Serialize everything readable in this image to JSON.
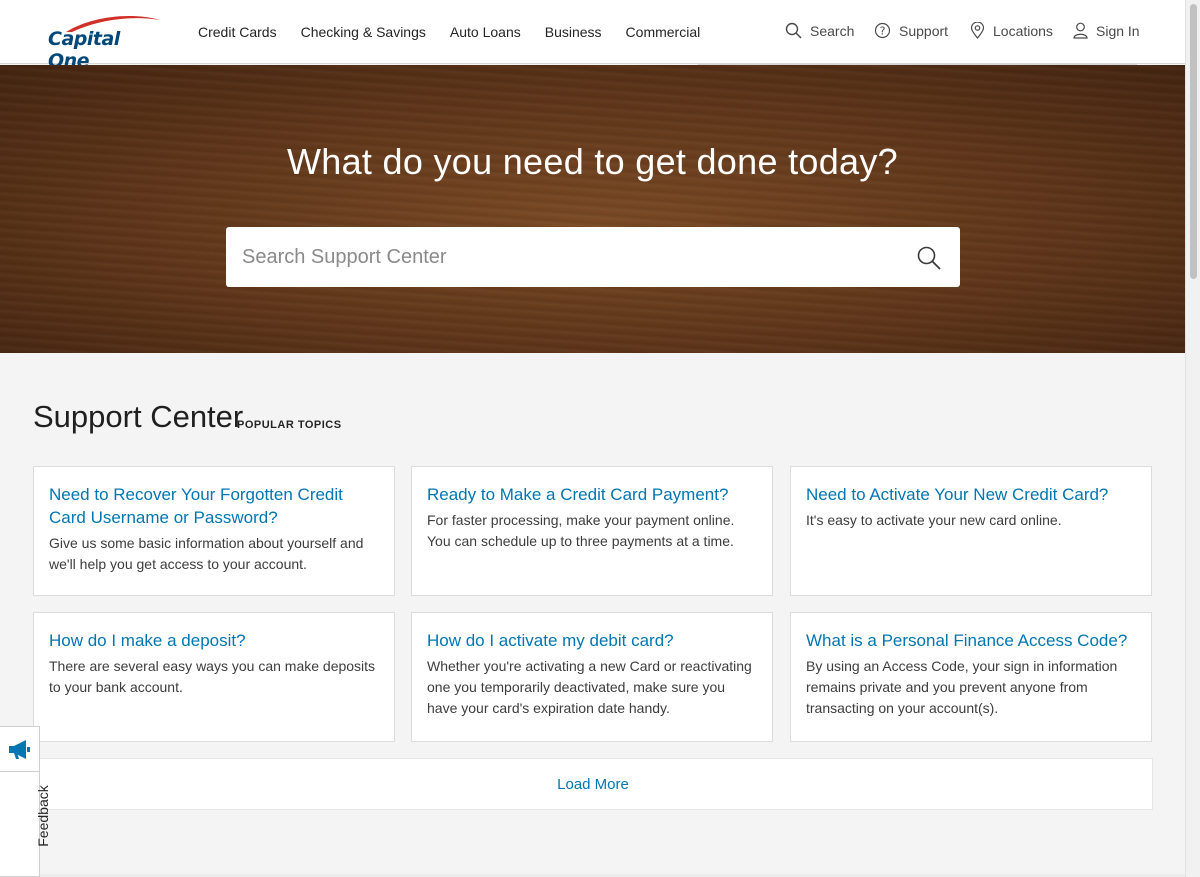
{
  "header": {
    "logo": "Capital One",
    "nav": [
      "Credit Cards",
      "Checking & Savings",
      "Auto Loans",
      "Business",
      "Commercial"
    ],
    "utility": {
      "search": "Search",
      "support": "Support",
      "locations": "Locations",
      "sign_in": "Sign In"
    }
  },
  "hero": {
    "title": "What do you need to get done today?",
    "search_placeholder": "Search Support Center"
  },
  "support_center": {
    "title": "Support Center",
    "subtitle": "POPULAR TOPICS",
    "cards": [
      {
        "title": "Need to Recover Your Forgotten Credit Card Username or Password?",
        "desc": "Give us some basic information about yourself and we'll help you get access to your account."
      },
      {
        "title": "Ready to Make a Credit Card Payment?",
        "desc": "For faster processing, make your payment online. You can schedule up to three payments at a time."
      },
      {
        "title": "Need to Activate Your New Credit Card?",
        "desc": "It's easy to activate your new card online."
      },
      {
        "title": "How do I make a deposit?",
        "desc": "There are several easy ways you can make deposits to your bank account."
      },
      {
        "title": "How do I activate my debit card?",
        "desc": "Whether you're activating a new Card or reactivating one you temporarily deactivated, make sure you have your card's expiration date handy."
      },
      {
        "title": "What is a Personal Finance Access Code?",
        "desc": "By using an Access Code, your sign in information remains private and you prevent anyone from transacting on your account(s)."
      }
    ],
    "load_more": "Load More"
  },
  "feedback": {
    "label": "Feedback",
    "icon": "megaphone-icon"
  },
  "colors": {
    "brand": "#004879",
    "accent_red": "#d03027",
    "link": "#0276b1"
  }
}
